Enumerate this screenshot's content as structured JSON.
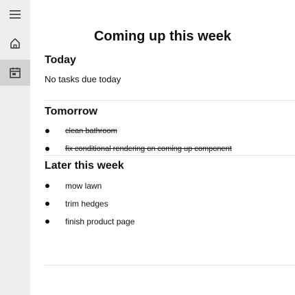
{
  "sidebar": {
    "menu_icon": "hamburger-menu-icon",
    "nav": [
      {
        "icon": "home-icon",
        "active": false
      },
      {
        "icon": "calendar-icon",
        "active": true
      }
    ]
  },
  "main": {
    "title": "Coming up this week",
    "today": {
      "heading": "Today",
      "empty_text": "No tasks due today"
    },
    "tomorrow": {
      "heading": "Tomorrow",
      "tasks": [
        {
          "label": "clean bathroom",
          "done": true
        },
        {
          "label": "fix conditional rendering on coming up component",
          "done": true
        }
      ]
    },
    "later": {
      "heading": "Later this week",
      "tasks": [
        {
          "label": "mow lawn",
          "done": false
        },
        {
          "label": "trim hedges",
          "done": false
        },
        {
          "label": "finish product page",
          "done": false
        }
      ]
    }
  },
  "colors": {
    "sidebar_bg": "#eeeeee",
    "active_nav_bg": "#d2d2d2",
    "divider": "#e6e6e6"
  }
}
